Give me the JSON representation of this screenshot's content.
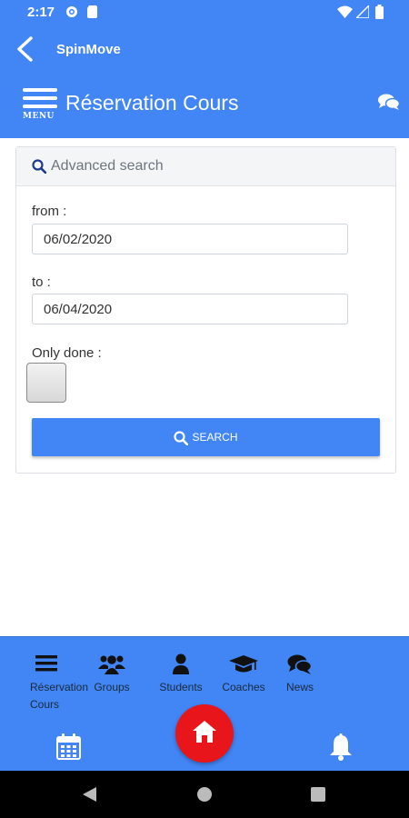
{
  "status_bar": {
    "time": "2:17"
  },
  "app_bar": {
    "title": "SpinMove"
  },
  "header": {
    "title": "Réservation Cours",
    "menu_label": "MENU"
  },
  "search_card": {
    "heading": "Advanced search",
    "from_label": "from :",
    "from_value": "06/02/2020",
    "to_label": "to :",
    "to_value": "06/04/2020",
    "only_done_label": "Only done :",
    "only_done_checked": false,
    "search_button": "SEARCH"
  },
  "bottom_nav": {
    "items": [
      {
        "label_line1": "Réservation",
        "label_line2": "Cours",
        "icon": "list-icon"
      },
      {
        "label_line1": "Groups",
        "label_line2": "",
        "icon": "users-icon"
      },
      {
        "label_line1": "Students",
        "label_line2": "",
        "icon": "user-icon"
      },
      {
        "label_line1": "Coaches",
        "label_line2": "",
        "icon": "graduation-cap-icon"
      },
      {
        "label_line1": "News",
        "label_line2": "",
        "icon": "comments-icon"
      }
    ]
  },
  "colors": {
    "primary": "#4285f4",
    "home_button": "#e8151b",
    "nav_text": "#1a2a3a"
  }
}
